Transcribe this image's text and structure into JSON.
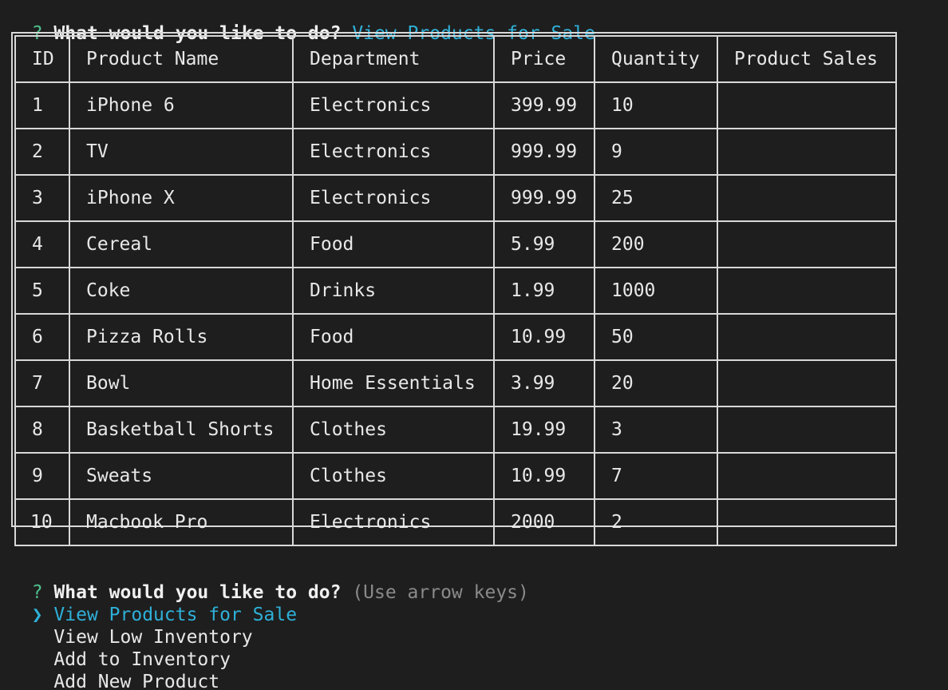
{
  "prompt1": {
    "mark": "?",
    "question": "What would you like to do?",
    "answer": "View Products for Sale"
  },
  "table": {
    "headers": [
      "ID",
      "Product Name",
      "Department",
      "Price",
      "Quantity",
      "Product Sales"
    ],
    "rows": [
      [
        "1",
        "iPhone 6",
        "Electronics",
        "399.99",
        "10",
        ""
      ],
      [
        "2",
        "TV",
        "Electronics",
        "999.99",
        "9",
        ""
      ],
      [
        "3",
        "iPhone X",
        "Electronics",
        "999.99",
        "25",
        ""
      ],
      [
        "4",
        "Cereal",
        "Food",
        "5.99",
        "200",
        ""
      ],
      [
        "5",
        "Coke",
        "Drinks",
        "1.99",
        "1000",
        ""
      ],
      [
        "6",
        "Pizza Rolls",
        "Food",
        "10.99",
        "50",
        ""
      ],
      [
        "7",
        "Bowl",
        "Home Essentials",
        "3.99",
        "20",
        ""
      ],
      [
        "8",
        "Basketball Shorts",
        "Clothes",
        "19.99",
        "3",
        ""
      ],
      [
        "9",
        "Sweats",
        "Clothes",
        "10.99",
        "7",
        ""
      ],
      [
        "10",
        "Macbook Pro",
        "Electronics",
        "2000",
        "2",
        ""
      ]
    ]
  },
  "prompt2": {
    "mark": "?",
    "question": "What would you like to do?",
    "hint": "(Use arrow keys)",
    "pointer": "❯",
    "options": [
      "View Products for Sale",
      "View Low Inventory",
      "Add to Inventory",
      "Add New Product"
    ],
    "selected_index": 0
  },
  "colors": {
    "background": "#1e1e1e",
    "question_mark": "#4fc08d",
    "answer": "#2eb0d8",
    "hint": "#8a8a8a",
    "border": "#d8d8d8"
  }
}
